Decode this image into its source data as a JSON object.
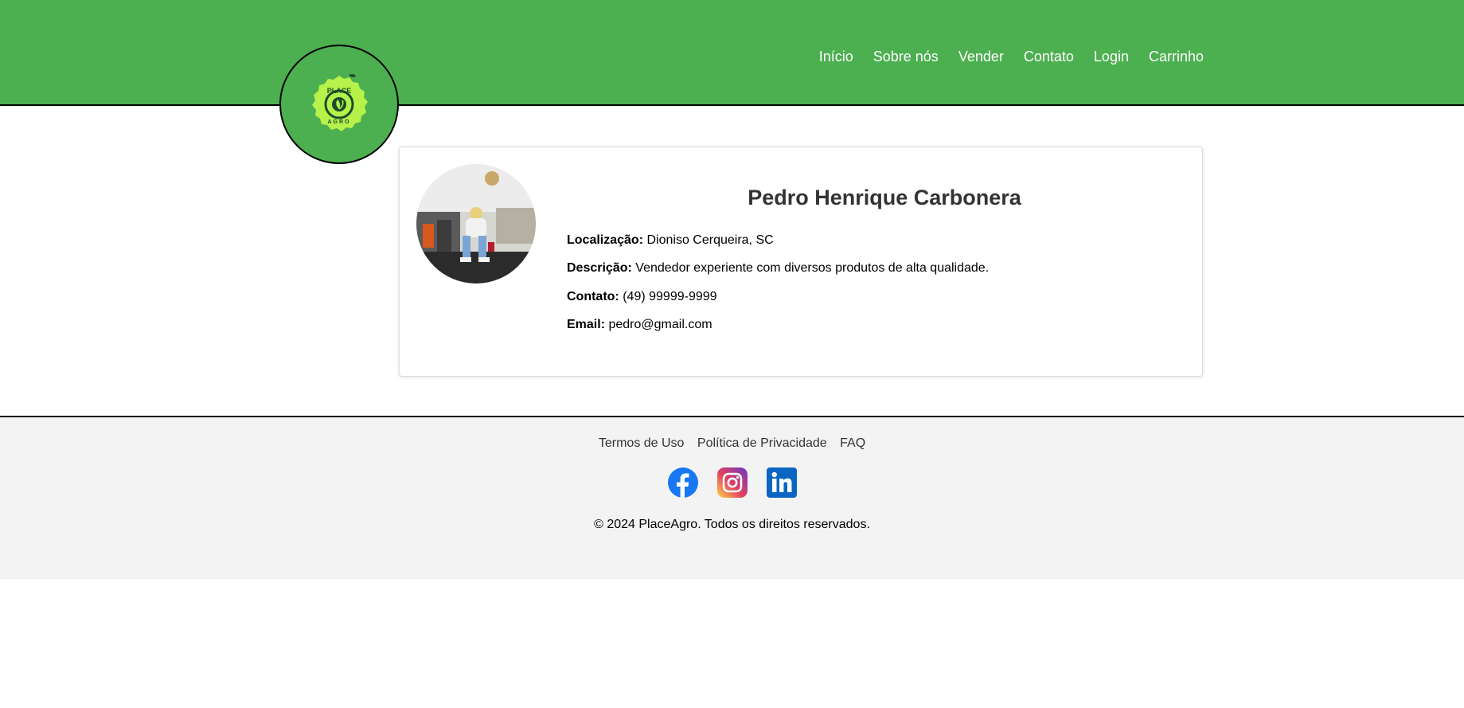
{
  "header": {
    "logo": {
      "top_text": "PLACE",
      "bottom_text": "AGRO",
      "icon": "leaf-icon"
    },
    "nav": [
      "Início",
      "Sobre nós",
      "Vender",
      "Contato",
      "Login",
      "Carrinho"
    ],
    "background_color": "#4caf50"
  },
  "profile": {
    "name": "Pedro Henrique Carbonera",
    "fields": [
      {
        "label": "Localização:",
        "value": "Dioniso Cerqueira, SC"
      },
      {
        "label": "Descrição:",
        "value": "Vendedor experiente com diversos produtos de alta qualidade."
      },
      {
        "label": "Contato:",
        "value": "(49) 99999-9999"
      },
      {
        "label": "Email:",
        "value": "pedro@gmail.com"
      }
    ]
  },
  "footer": {
    "links": [
      "Termos de Uso",
      "Política de Privacidade",
      "FAQ"
    ],
    "social": [
      "facebook-icon",
      "instagram-icon",
      "linkedin-icon"
    ],
    "copyright": "© 2024 PlaceAgro. Todos os direitos reservados."
  }
}
